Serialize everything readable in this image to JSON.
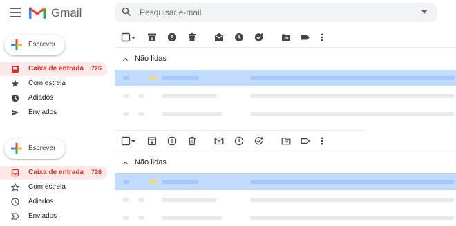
{
  "app": {
    "name": "Gmail"
  },
  "search": {
    "placeholder": "Pesquisar e-mail"
  },
  "compose": {
    "label": "Escrever"
  },
  "sidebar": {
    "items": [
      {
        "label": "Caixa de entrada",
        "count": "726",
        "icon": "inbox-icon",
        "active": true
      },
      {
        "label": "Com estrela",
        "count": "",
        "icon": "star-icon",
        "active": false
      },
      {
        "label": "Adiados",
        "count": "",
        "icon": "clock-icon",
        "active": false
      },
      {
        "label": "Enviados",
        "count": "",
        "icon": "send-icon",
        "active": false
      }
    ]
  },
  "toolbar": {
    "icons": [
      "select-checkbox-icon",
      "archive-icon",
      "report-spam-icon",
      "delete-icon",
      "mark-read-icon",
      "snooze-icon",
      "add-task-icon",
      "move-to-icon",
      "label-icon",
      "more-vert-icon"
    ]
  },
  "section": {
    "label": "Não lidas"
  },
  "colors": {
    "accent": "#d93025",
    "selected_row": "#c2dbff",
    "active_nav_bg": "#fce8e6"
  }
}
